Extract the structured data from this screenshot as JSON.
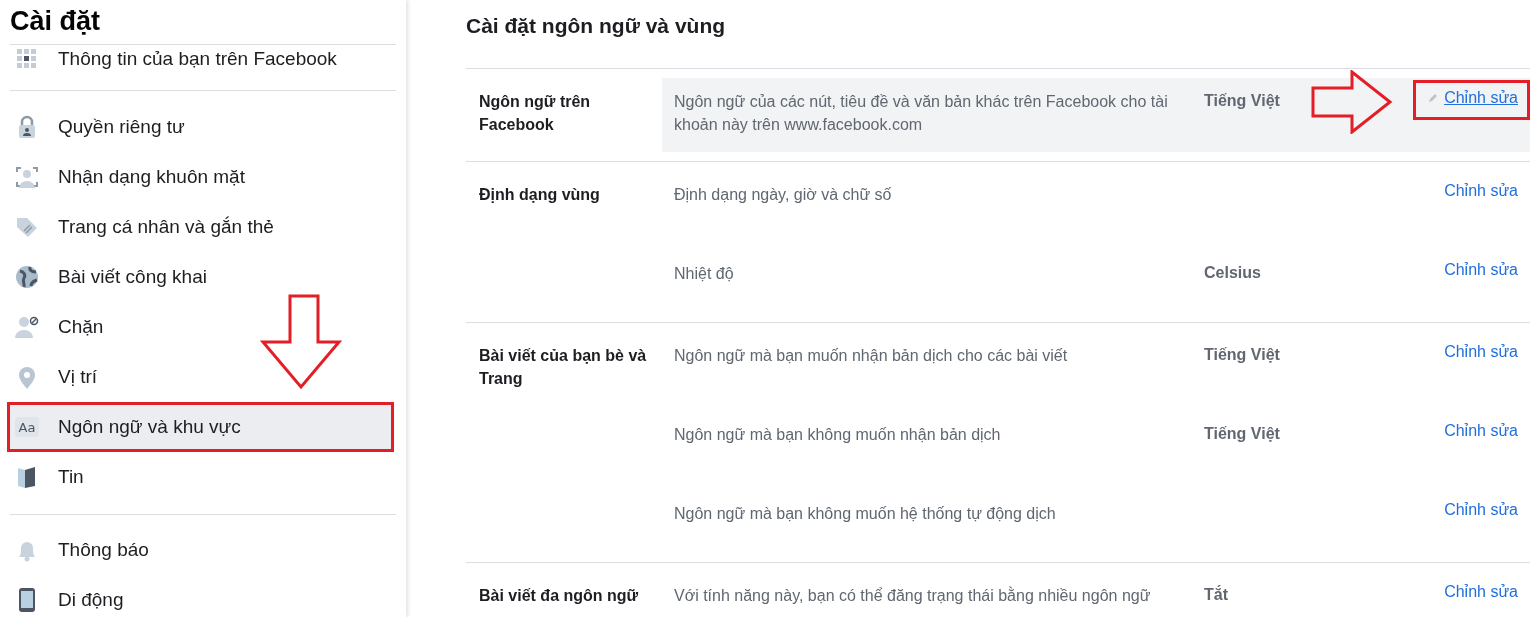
{
  "sidebar": {
    "title": "Cài đặt",
    "groups": [
      {
        "items": [
          {
            "label": "Thông tin của bạn trên Facebook",
            "kind": "grid",
            "selected": false,
            "highlight": false
          }
        ]
      },
      {
        "items": [
          {
            "label": "Quyền riêng tư",
            "kind": "lock",
            "selected": false,
            "highlight": false
          },
          {
            "label": "Nhận dạng khuôn mặt",
            "kind": "face",
            "selected": false,
            "highlight": false
          },
          {
            "label": "Trang cá nhân và gắn thẻ",
            "kind": "tag",
            "selected": false,
            "highlight": false
          },
          {
            "label": "Bài viết công khai",
            "kind": "globe",
            "selected": false,
            "highlight": false
          },
          {
            "label": "Chặn",
            "kind": "block",
            "selected": false,
            "highlight": false
          },
          {
            "label": "Vị trí",
            "kind": "pin",
            "selected": false,
            "highlight": false
          },
          {
            "label": "Ngôn ngữ và khu vực",
            "kind": "text",
            "icon_text": "Aa",
            "selected": true,
            "highlight": true
          },
          {
            "label": "Tin",
            "kind": "book",
            "selected": false,
            "highlight": false
          }
        ]
      },
      {
        "items": [
          {
            "label": "Thông báo",
            "kind": "bell",
            "selected": false,
            "highlight": false
          },
          {
            "label": "Di động",
            "kind": "phone",
            "selected": false,
            "highlight": false
          }
        ]
      }
    ]
  },
  "main": {
    "title": "Cài đặt ngôn ngữ và vùng",
    "sections": [
      {
        "label": "Ngôn ngữ trên Facebook",
        "rows": [
          {
            "description": "Ngôn ngữ của các nút, tiêu đề và văn bản khác trên Facebook cho tài khoản này trên www.facebook.com",
            "value": "Tiếng Việt",
            "action": "Chỉnh sửa",
            "hovered": true,
            "highlight": true
          }
        ]
      },
      {
        "label": "Định dạng vùng",
        "rows": [
          {
            "description": "Định dạng ngày, giờ và chữ số",
            "action": "Chỉnh sửa",
            "hovered": false,
            "highlight": false
          },
          {
            "description": "Nhiệt độ",
            "value": "Celsius",
            "action": "Chỉnh sửa",
            "hovered": false,
            "highlight": false
          }
        ]
      },
      {
        "label": "Bài viết của bạn bè và Trang",
        "rows": [
          {
            "description": "Ngôn ngữ mà bạn muốn nhận bản dịch cho các bài viết",
            "value": "Tiếng Việt",
            "action": "Chỉnh sửa",
            "hovered": false,
            "highlight": false
          },
          {
            "description": "Ngôn ngữ mà bạn không muốn nhận bản dịch",
            "value": "Tiếng Việt",
            "action": "Chỉnh sửa",
            "hovered": false,
            "highlight": false
          },
          {
            "description": "Ngôn ngữ mà bạn không muốn hệ thống tự động dịch",
            "action": "Chỉnh sửa",
            "hovered": false,
            "highlight": false
          }
        ]
      },
      {
        "label": "Bài viết đa ngôn ngữ",
        "rows": [
          {
            "description": "Với tính năng này, bạn có thể đăng trạng thái bằng nhiều ngôn ngữ",
            "value": "Tắt",
            "action": "Chỉnh sửa",
            "hovered": false,
            "highlight": false
          }
        ]
      }
    ]
  }
}
